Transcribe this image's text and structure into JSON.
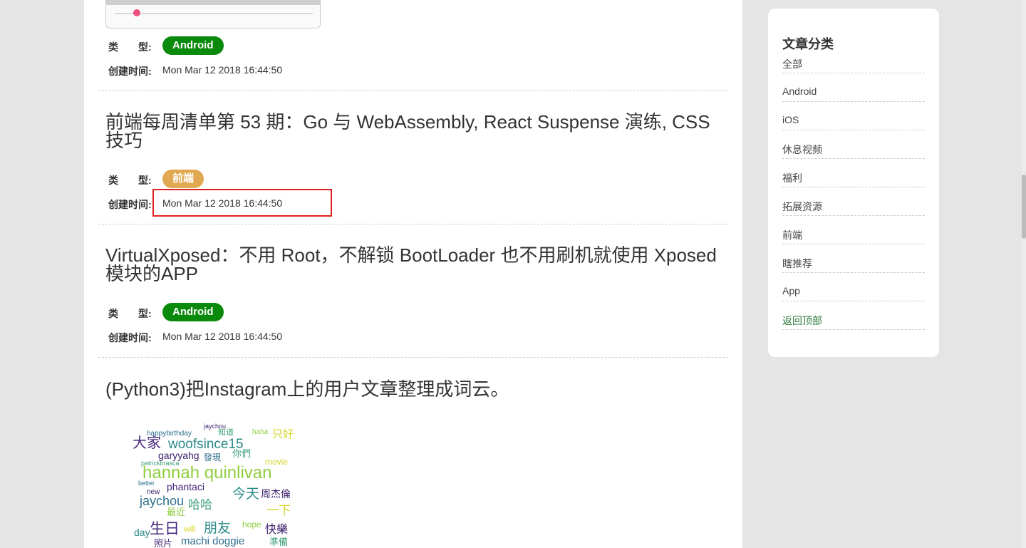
{
  "posts": [
    {
      "type_label": "类　　型:",
      "tag": "Android",
      "time_label": "创建时间:",
      "time": "Mon Mar 12 2018 16:44:50"
    },
    {
      "title": "前端每周清单第 53 期：Go 与 WebAssembly, React Suspense 演练, CSS 技巧",
      "type_label": "类　　型:",
      "tag": "前端",
      "time_label": "创建时间:",
      "time": "Mon Mar 12 2018 16:44:50"
    },
    {
      "title": "VirtualXposed：不用 Root，不解锁 BootLoader 也不用刷机就使用 Xposed 模块的APP",
      "type_label": "类　　型:",
      "tag": "Android",
      "time_label": "创建时间:",
      "time": "Mon Mar 12 2018 16:44:50"
    },
    {
      "title": "(Python3)把Instagram上的用户文章整理成词云。"
    }
  ],
  "wordcloud_words": [
    "jaychou",
    "happybirthday",
    "知道",
    "haha",
    "只好",
    "大家",
    "woofsince15",
    "garyyahg",
    "發現",
    "你們",
    "hannah quinlivan",
    "movie",
    "phantaci",
    "今天",
    "周杰倫",
    "jaychou",
    "哈哈",
    "最近",
    "一下",
    "生日",
    "朋友",
    "快樂",
    "machi doggie",
    "準備",
    "hope",
    "will",
    "照片",
    "day",
    "new",
    "better",
    "patrickbrasca"
  ],
  "sidebar": {
    "heading": "文章分类",
    "items": [
      {
        "label": "全部"
      },
      {
        "label": "Android"
      },
      {
        "label": "iOS"
      },
      {
        "label": "休息视频"
      },
      {
        "label": "福利"
      },
      {
        "label": "拓展资源"
      },
      {
        "label": "前端"
      },
      {
        "label": "瞎推荐"
      },
      {
        "label": "App"
      },
      {
        "label": "返回顶部"
      }
    ]
  },
  "colors": {
    "android_tag": "#0a8a0a",
    "web_tag": "#e0a850",
    "highlight": "#e02020",
    "back_link": "#2a7a3a"
  }
}
